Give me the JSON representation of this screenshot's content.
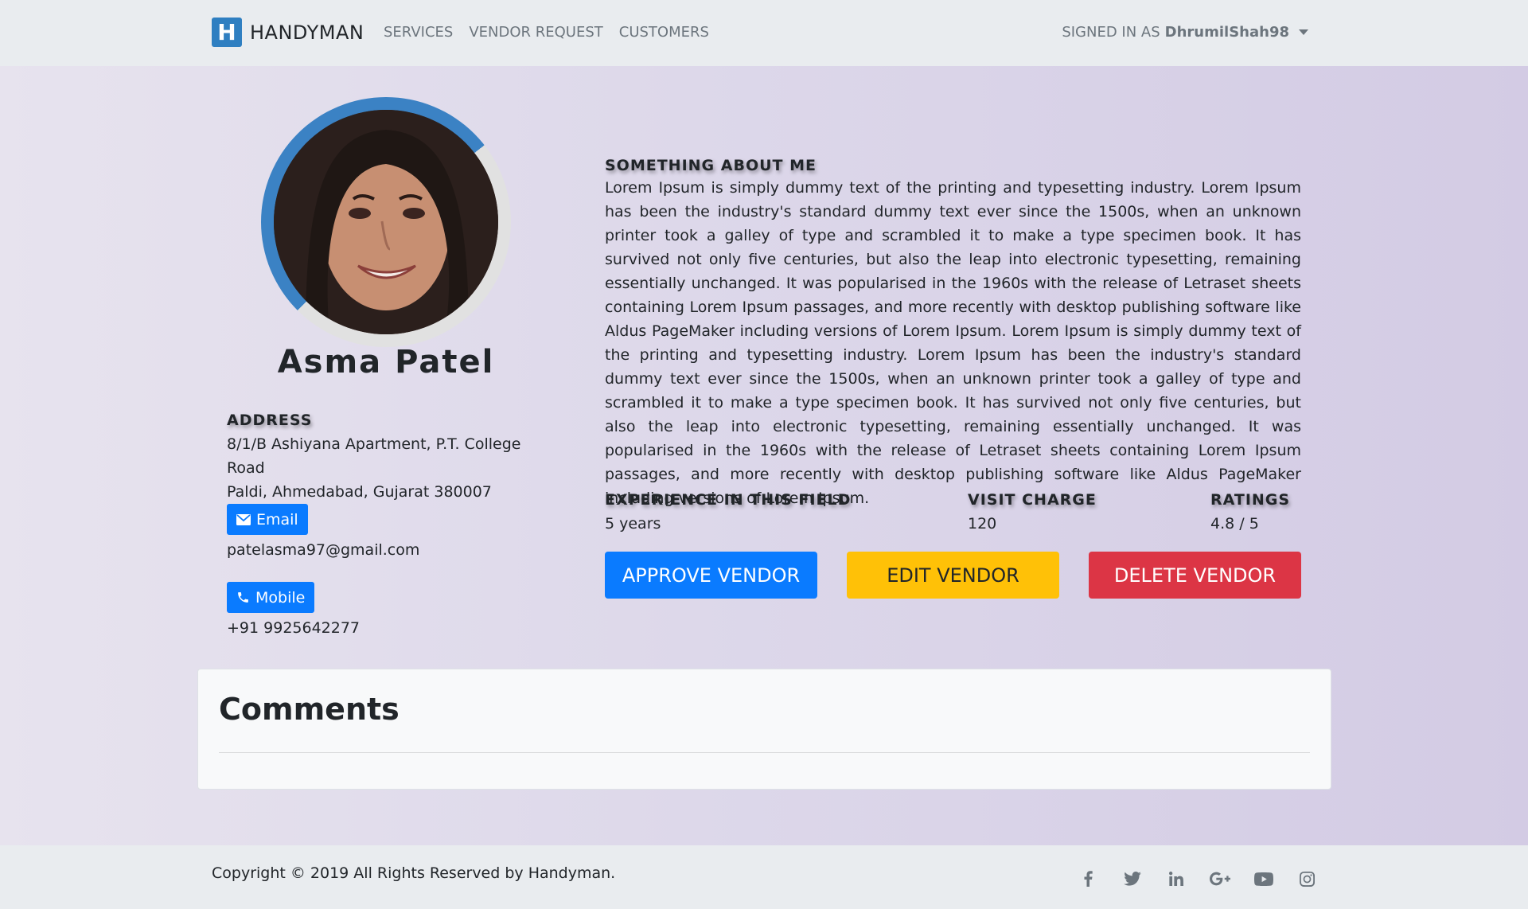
{
  "navbar": {
    "brand_initial": "H",
    "brand_name": "HANDYMAN",
    "links": [
      "SERVICES",
      "VENDOR REQUEST",
      "CUSTOMERS"
    ],
    "signed_in_prefix": "SIGNED IN AS",
    "username": "DhrumilShah98"
  },
  "profile": {
    "name": "Asma Patel",
    "address_heading": "ADDRESS",
    "address_line1": "8/1/B Ashiyana Apartment, P.T. College Road",
    "address_line2": "Paldi, Ahmedabad, Gujarat 380007",
    "email_label": "Email",
    "email": "patelasma97@gmail.com",
    "mobile_label": "Mobile",
    "mobile": "+91 9925642277"
  },
  "about": {
    "heading": "SOMETHING ABOUT ME",
    "text": "Lorem Ipsum is simply dummy text of the printing and typesetting industry. Lorem Ipsum has been the industry's standard dummy text ever since the 1500s, when an unknown printer took a galley of type and scrambled it to make a type specimen book. It has survived not only five centuries, but also the leap into electronic typesetting, remaining essentially unchanged. It was popularised in the 1960s with the release of Letraset sheets containing Lorem Ipsum passages, and more recently with desktop publishing software like Aldus PageMaker including versions of Lorem Ipsum. Lorem Ipsum is simply dummy text of the printing and typesetting industry. Lorem Ipsum has been the industry's standard dummy text ever since the 1500s, when an unknown printer took a galley of type and scrambled it to make a type specimen book. It has survived not only five centuries, but also the leap into electronic typesetting, remaining essentially unchanged. It was popularised in the 1960s with the release of Letraset sheets containing Lorem Ipsum passages, and more recently with desktop publishing software like Aldus PageMaker including versions of Lorem Ipsum."
  },
  "stats": {
    "experience_label": "EXPERIENCE IN THIS FIELD",
    "experience_value": "5 years",
    "visit_charge_label": "VISIT CHARGE",
    "visit_charge_value": "120",
    "ratings_label": "RATINGS",
    "ratings_value": "4.8 / 5"
  },
  "actions": {
    "approve": "APPROVE VENDOR",
    "edit": "EDIT VENDOR",
    "delete": "DELETE VENDOR"
  },
  "comments": {
    "heading": "Comments"
  },
  "footer": {
    "copyright": "Copyright © 2019 All Rights Reserved by Handyman.",
    "social_icons": [
      "facebook-icon",
      "twitter-icon",
      "linkedin-icon",
      "google-plus-icon",
      "youtube-icon",
      "instagram-icon"
    ]
  },
  "colors": {
    "primary": "#0a7bff",
    "warning": "#ffc107",
    "danger": "#dc3545",
    "brand_blue": "#2f7fc1",
    "navbar_bg": "#e9ecef"
  }
}
